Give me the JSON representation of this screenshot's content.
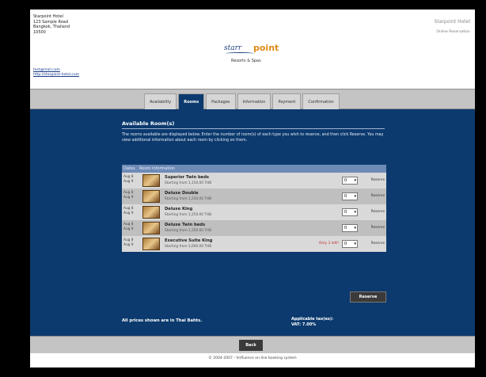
{
  "header": {
    "address": [
      "Starpoint Hotel",
      "123 Sample Road",
      "Bangkok, Thailand",
      "10500"
    ],
    "email": "test@mail.com",
    "website": "http://starpoint-hotel.com",
    "logo_word": "starr",
    "logo_accent": "point",
    "tagline": "Resorts & Spas",
    "right_name": "Starpoint Hotel",
    "right_sub": "Online Reservation"
  },
  "tabs": [
    {
      "label": "Availability",
      "active": false
    },
    {
      "label": "Rooms",
      "active": true
    },
    {
      "label": "Packages",
      "active": false
    },
    {
      "label": "Information",
      "active": false
    },
    {
      "label": "Payment",
      "active": false
    },
    {
      "label": "Confirmation",
      "active": false
    }
  ],
  "section": {
    "title": "Available Room(s)",
    "intro": "The rooms available are displayed below. Enter the number of room(s) of each type you wish to reserve, and then click Reserve. You may view additional information about each room by clicking on them."
  },
  "table": {
    "headers": [
      "Dates",
      "Room Information"
    ],
    "rows": [
      {
        "dates": [
          "Aug 8",
          "Aug 9"
        ],
        "name": "Superior Twin beds",
        "price": "Starting from 1,150.00 THB",
        "left": "",
        "qty": "0",
        "reserve": "Reserve"
      },
      {
        "dates": [
          "Aug 8",
          "Aug 9"
        ],
        "name": "Deluxe Double",
        "price": "Starting from 1,250.00 THB",
        "left": "",
        "qty": "0",
        "reserve": "Reserve"
      },
      {
        "dates": [
          "Aug 8",
          "Aug 9"
        ],
        "name": "Deluxe King",
        "price": "Starting from 1,250.00 THB",
        "left": "",
        "qty": "0",
        "reserve": "Reserve"
      },
      {
        "dates": [
          "Aug 8",
          "Aug 9"
        ],
        "name": "Deluxe Twin beds",
        "price": "Starting from 1,350.00 THB",
        "left": "",
        "qty": "0",
        "reserve": "Reserve"
      },
      {
        "dates": [
          "Aug 8",
          "Aug 9"
        ],
        "name": "Executive Suite King",
        "price": "Starting from 1,600.00 THB",
        "left": "Only 1 left!",
        "qty": "0",
        "reserve": "Reserve"
      }
    ]
  },
  "buttons": {
    "reserve": "Reserve",
    "back": "Back"
  },
  "footer": {
    "note": "All prices shown are in Thai Bahts.",
    "taxes_title": "Applicable tax(es):",
    "taxes_value": "VAT: 7.00%",
    "copyright": "© 2004-2007 - Vnfluence on-line booking system"
  },
  "colors": {
    "main_bg": "#0c3a6e",
    "bar_bg": "#c4c4c4",
    "accent": "#e08a15",
    "warning": "#c0282a"
  }
}
